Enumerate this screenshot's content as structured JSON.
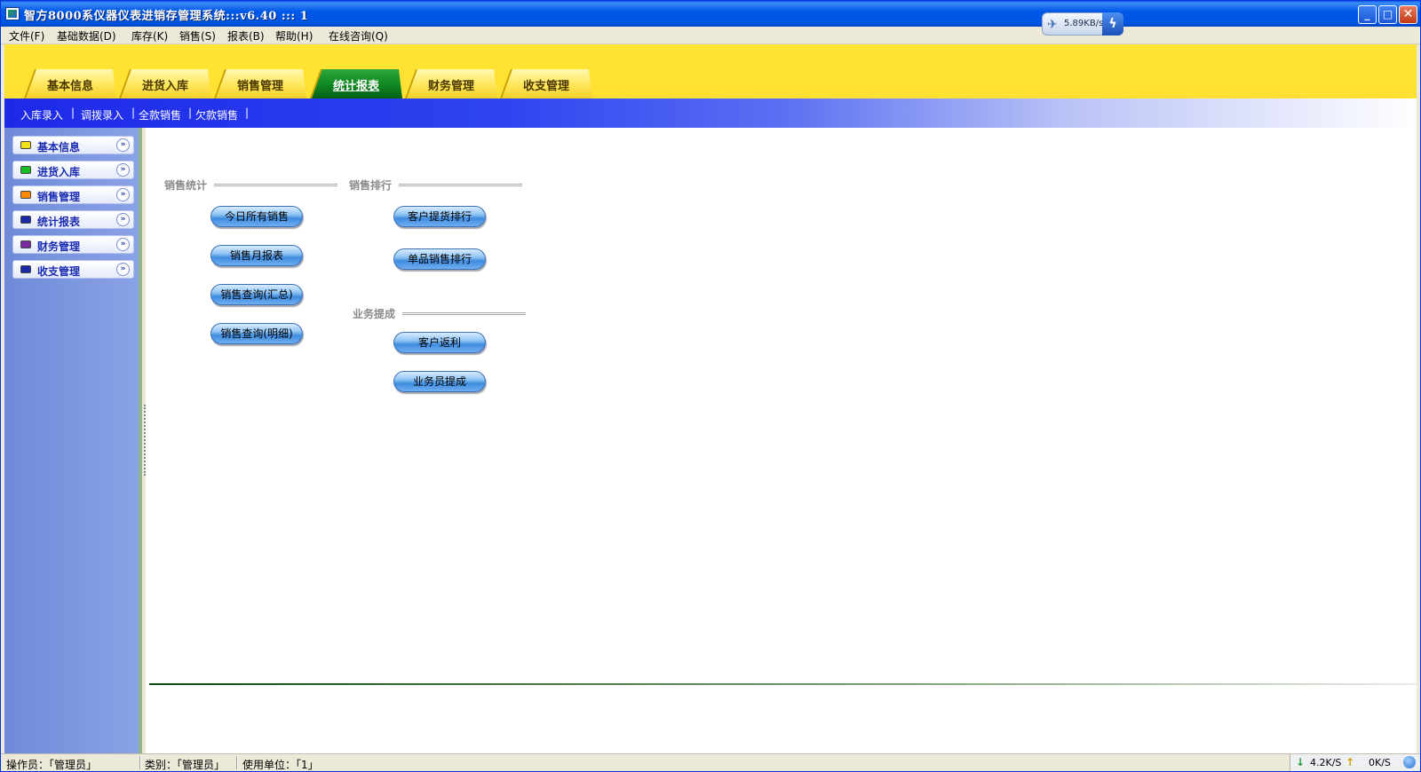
{
  "window": {
    "title": "智方8000系仪器仪表进销存管理系统:::v6.40  :::  1",
    "net_speed": "5.89KB/s",
    "buttons": {
      "minimize": "_",
      "maximize": "□",
      "close": "✕"
    }
  },
  "menu": [
    {
      "label": "文件(F)"
    },
    {
      "label": "基础数据(D)"
    },
    {
      "label": "库存(K)"
    },
    {
      "label": "销售(S)"
    },
    {
      "label": "报表(B)"
    },
    {
      "label": "帮助(H)"
    },
    {
      "label": "在线咨询(Q)"
    }
  ],
  "tabs": [
    {
      "label": "基本信息",
      "active": false
    },
    {
      "label": "进货入库",
      "active": false
    },
    {
      "label": "销售管理",
      "active": false
    },
    {
      "label": "统计报表",
      "active": true
    },
    {
      "label": "财务管理",
      "active": false
    },
    {
      "label": "收支管理",
      "active": false
    }
  ],
  "subnav": {
    "items": [
      {
        "label": "入库录入"
      },
      {
        "label": "调拨录入"
      },
      {
        "label": "全款销售"
      },
      {
        "label": "欠款销售"
      }
    ],
    "separator": "|"
  },
  "sidebar": {
    "items": [
      {
        "label": "基本信息",
        "color": "#f2e21a"
      },
      {
        "label": "进货入库",
        "color": "#16c020"
      },
      {
        "label": "销售管理",
        "color": "#ff8a00"
      },
      {
        "label": "统计报表",
        "color": "#1a2aa8"
      },
      {
        "label": "财务管理",
        "color": "#7a2aa0"
      },
      {
        "label": "收支管理",
        "color": "#1a2aa8"
      }
    ],
    "chevron": "»"
  },
  "sections": {
    "sales_stats": {
      "title": "销售统计",
      "buttons": [
        "今日所有销售",
        "销售月报表",
        "销售查询(汇总)",
        "销售查询(明细)"
      ]
    },
    "sales_ranking": {
      "title": "销售排行",
      "buttons": [
        "客户提货排行",
        "单品销售排行"
      ]
    },
    "commission": {
      "title": "业务提成",
      "buttons": [
        "客户返利",
        "业务员提成"
      ]
    }
  },
  "statusbar": {
    "operator": "操作员：「管理员」",
    "category": "类别：「管理员」",
    "unit": "使用单位：「1」",
    "download_speed": "4.2K/S",
    "upload_speed": "0K/S"
  }
}
